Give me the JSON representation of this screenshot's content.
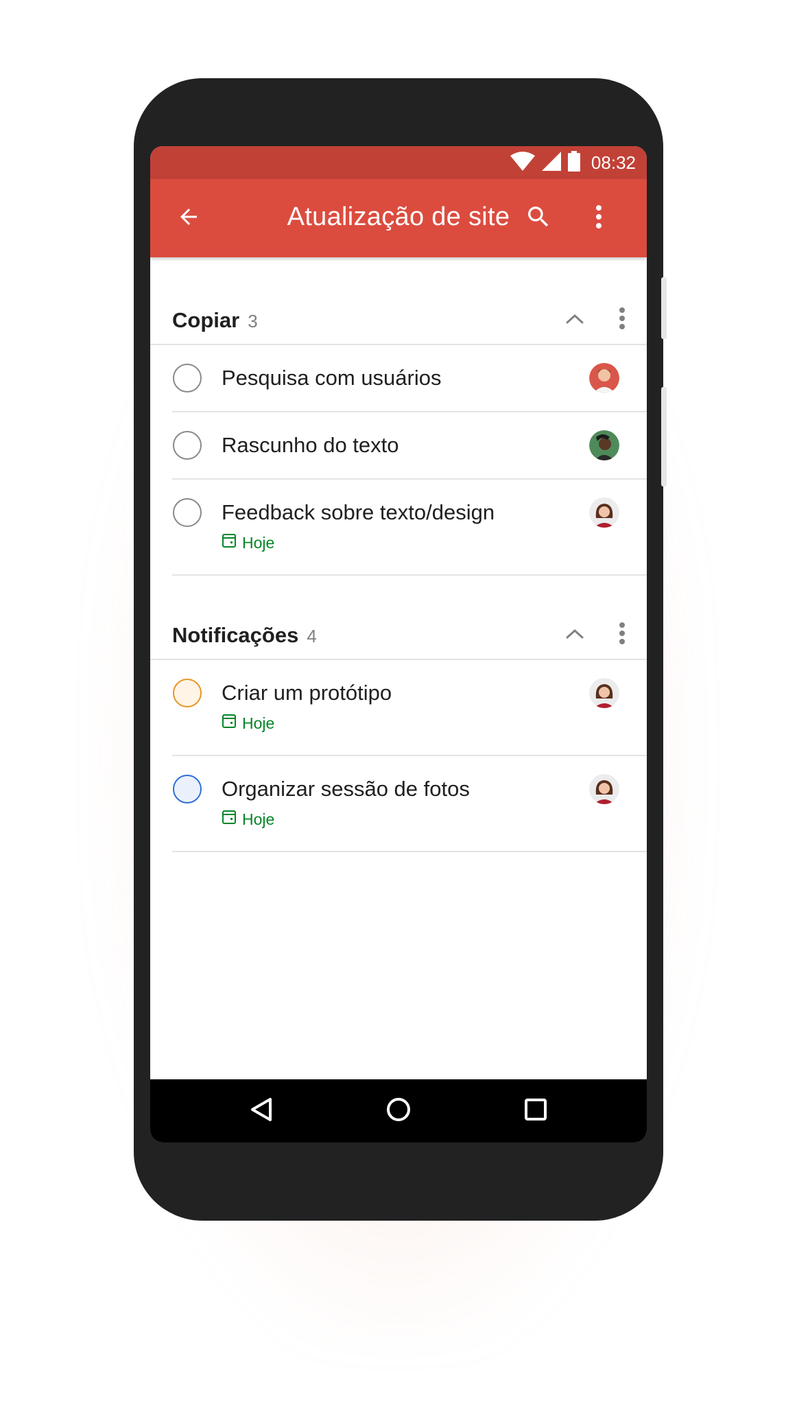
{
  "status_bar": {
    "time": "08:32",
    "icons": [
      "wifi-icon",
      "cell-signal-icon",
      "battery-icon"
    ]
  },
  "app_bar": {
    "title": "Atualização de site",
    "icons": [
      "back-arrow-icon",
      "search-icon",
      "overflow-menu-icon"
    ],
    "background_color": "#db4c3f",
    "status_color": "#c24136"
  },
  "sections": [
    {
      "title": "Copiar",
      "count": "3",
      "tasks": [
        {
          "title": "Pesquisa com usuários",
          "due": "",
          "priority_color": "#8a8a8a"
        },
        {
          "title": "Rascunho do texto",
          "due": "",
          "priority_color": "#8a8a8a"
        },
        {
          "title": "Feedback sobre texto/design",
          "due": "Hoje",
          "priority_color": "#8a8a8a"
        }
      ]
    },
    {
      "title": "Notificações",
      "count": "4",
      "tasks": [
        {
          "title": "Criar um protótipo",
          "due": "Hoje",
          "priority_color": "#e8962a"
        },
        {
          "title": "Organizar sessão de fotos",
          "due": "Hoje",
          "priority_color": "#2f6fd6"
        }
      ]
    }
  ],
  "colors": {
    "due_green": "#058527",
    "text": "#202020",
    "divider": "#e3e3e3"
  },
  "nav_bar": {
    "icons": [
      "nav-back-icon",
      "nav-home-icon",
      "nav-recents-icon"
    ]
  }
}
